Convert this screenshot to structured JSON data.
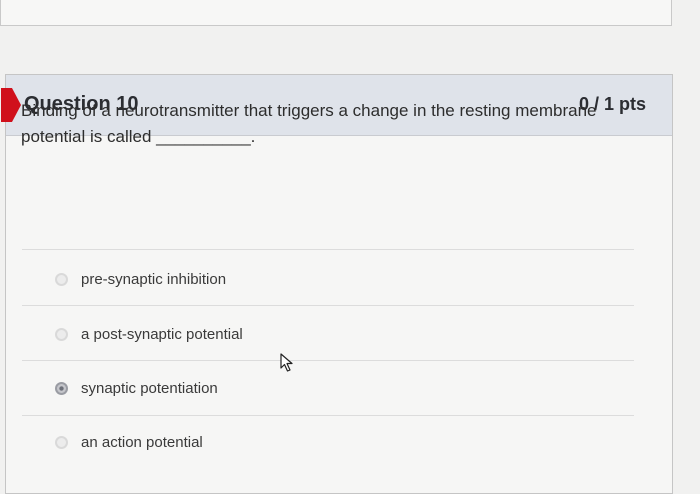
{
  "question": {
    "title": "Question 10",
    "points": "0 / 1 pts",
    "text": "Binding of a neurotransmitter that triggers a change in the resting membrane potential is called __________."
  },
  "options": [
    {
      "label": "pre-synaptic inhibition",
      "selected": false
    },
    {
      "label": "a post-synaptic potential",
      "selected": false
    },
    {
      "label": "synaptic potentiation",
      "selected": true
    },
    {
      "label": "an action potential",
      "selected": false
    }
  ],
  "colors": {
    "marker": "#d0101b",
    "header_bg": "#dfe3ea"
  }
}
